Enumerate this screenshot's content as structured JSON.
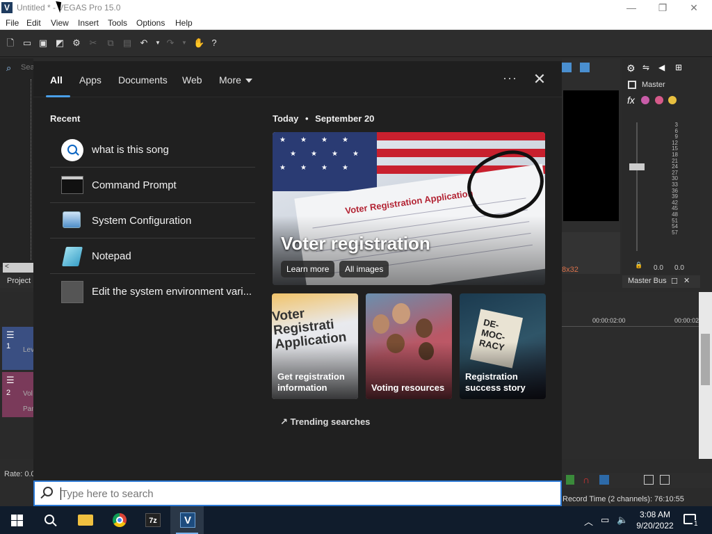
{
  "app": {
    "title": "Untitled * - VEGAS Pro 15.0",
    "icon_letter": "V",
    "menu": [
      "File",
      "Edit",
      "View",
      "Insert",
      "Tools",
      "Options",
      "Help"
    ],
    "window_controls": [
      "minimize-icon",
      "restore-icon",
      "close-icon"
    ],
    "left_pane": {
      "search_placeholder": "Sea",
      "project_tab": "Project",
      "rate_label": "Rate: 0.0"
    },
    "tracks": [
      {
        "number": "1",
        "label": "Lev"
      },
      {
        "number": "2",
        "label": "Vol",
        "sub_label": "Pan"
      }
    ],
    "preview": {
      "resolution_fragment": "8x32"
    },
    "master": {
      "label": "Master",
      "meter_scale": [
        "3",
        "6",
        "9",
        "12",
        "15",
        "18",
        "21",
        "24",
        "27",
        "30",
        "33",
        "36",
        "39",
        "42",
        "45",
        "48",
        "51",
        "54",
        "57"
      ],
      "level_left": "0.0",
      "level_right": "0.0",
      "bus_label": "Master Bus"
    },
    "timeline": {
      "timecode_1": "00:00:02:00",
      "timecode_2": "00:00:02"
    },
    "record_time": "Record Time (2 channels): 76:10:55"
  },
  "search_flyout": {
    "tabs": [
      {
        "label": "All",
        "active": true
      },
      {
        "label": "Apps"
      },
      {
        "label": "Documents"
      },
      {
        "label": "Web"
      },
      {
        "label": "More"
      }
    ],
    "more_options": "···",
    "recent_title": "Recent",
    "recent_items": [
      {
        "label": "what is this song",
        "icon": "search-icon"
      },
      {
        "label": "Command Prompt",
        "icon": "command-prompt-icon"
      },
      {
        "label": "System Configuration",
        "icon": "system-configuration-icon"
      },
      {
        "label": "Notepad",
        "icon": "notepad-icon"
      },
      {
        "label": "Edit the system environment vari...",
        "icon": "environment-variables-icon"
      }
    ],
    "today": {
      "label": "Today",
      "separator": "•",
      "date": "September 20"
    },
    "hero": {
      "title": "Voter registration",
      "doc_text": "Voter Registration Application",
      "buttons": [
        "Learn more",
        "All images"
      ]
    },
    "cards": [
      {
        "label": "Get registration information",
        "image_text": "Voter Registrati Application"
      },
      {
        "label": "Voting resources"
      },
      {
        "label": "Registration success story",
        "image_text": "DE-MOC-RACY"
      }
    ],
    "trending_label": "Trending searches",
    "searchbox": {
      "placeholder": "Type here to search"
    }
  },
  "taskbar": {
    "apps": [
      "start-icon",
      "search-icon",
      "file-explorer-icon",
      "chrome-icon",
      "7zip-icon",
      "vegas-icon"
    ],
    "zip_label": "7z",
    "vegas_label": "V",
    "clock": {
      "time": "3:08 AM",
      "date": "9/20/2022"
    },
    "notification_count": "1"
  },
  "colors": {
    "accent": "#4a9fe8",
    "search_border": "#2a78d4",
    "taskbar": "#101c2c",
    "flyout_bg": "#202020"
  }
}
